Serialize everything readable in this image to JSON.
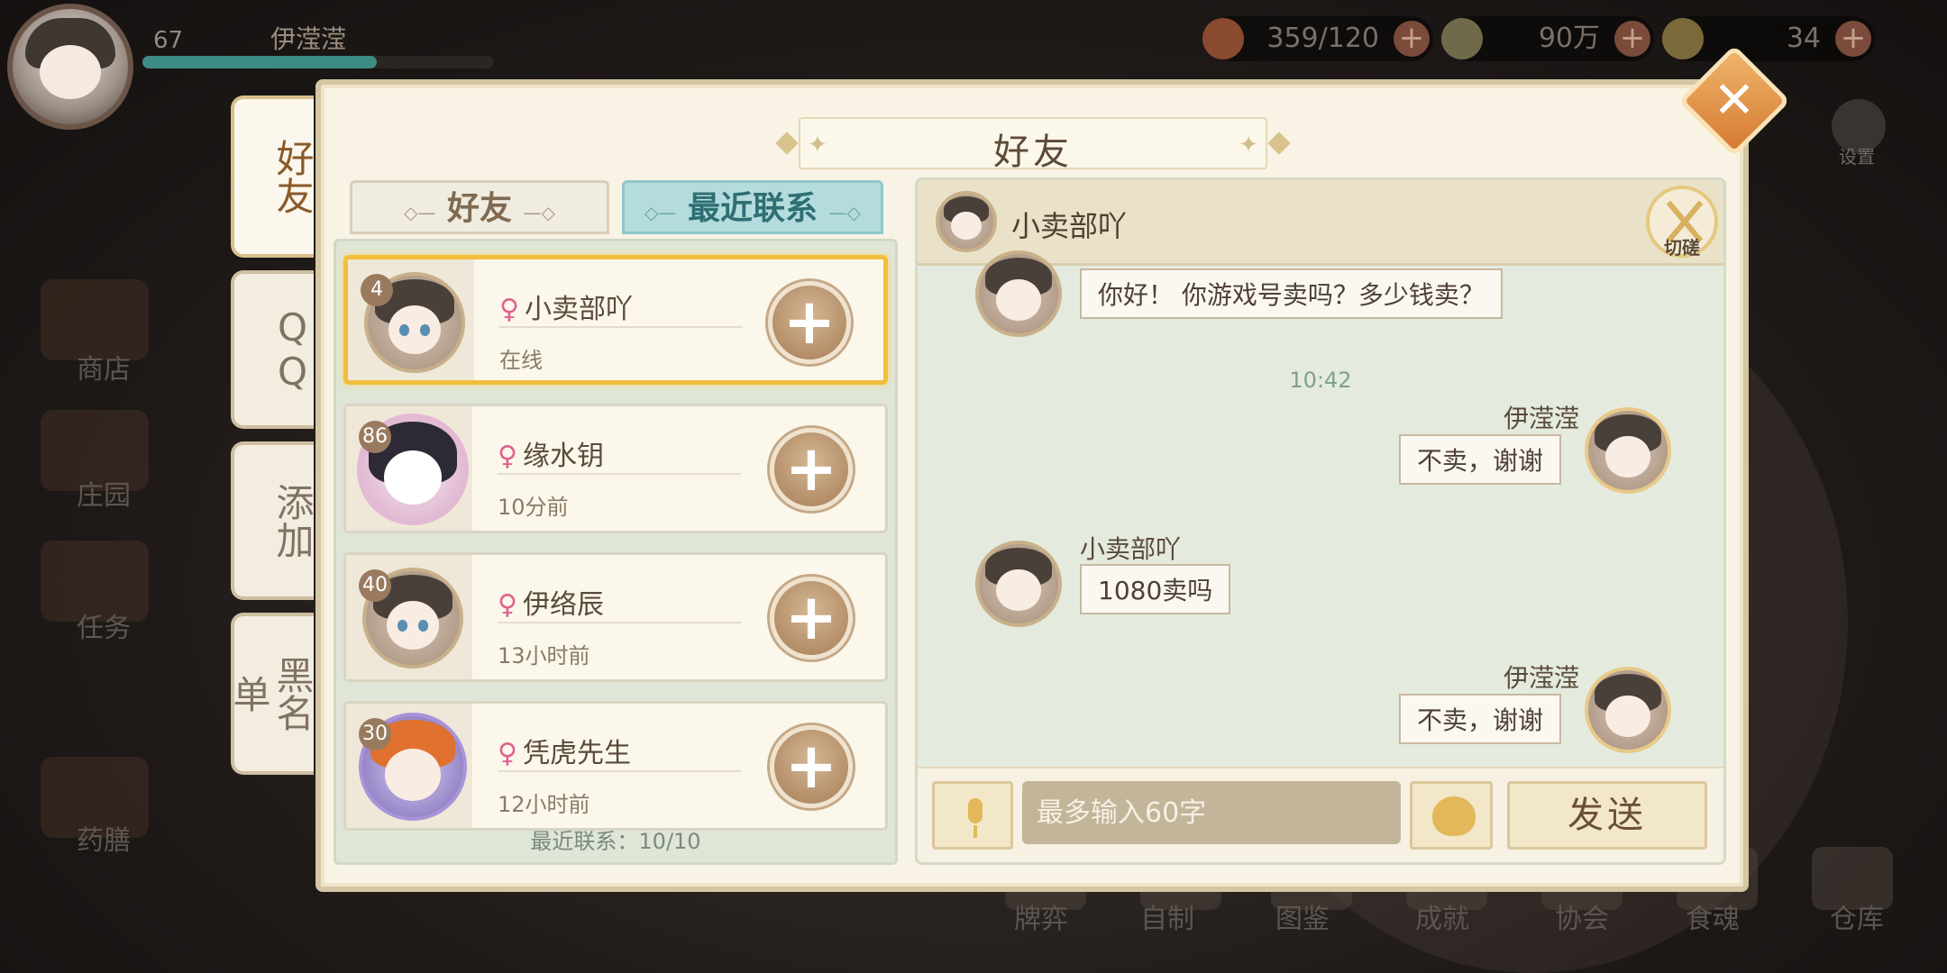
{
  "hud": {
    "level": "67",
    "player_name": "伊滢滢",
    "resources": [
      {
        "icon": "stamina-bowl-icon",
        "value": "359/120"
      },
      {
        "icon": "feather-coin-icon",
        "value": "90万"
      },
      {
        "icon": "gem-icon",
        "value": "34"
      }
    ],
    "settings_label": "设置"
  },
  "side_menu": {
    "items": [
      "商店",
      "庄园",
      "任务",
      "药膳"
    ]
  },
  "bottom_bar": {
    "items": [
      "牌弈",
      "自制",
      "图鉴",
      "成就",
      "协会",
      "食魂",
      "仓库"
    ]
  },
  "dialog": {
    "title": "好友",
    "vertical_tabs": [
      "好友",
      "QQ",
      "添加",
      "黑名单"
    ],
    "list_tabs": {
      "friends": "好友",
      "recent": "最近联系"
    },
    "friends": [
      {
        "level": "4",
        "name": "小卖部吖",
        "status": "在线",
        "gender": "♀"
      },
      {
        "level": "86",
        "name": "缘水钥",
        "status": "10分前",
        "gender": "♀"
      },
      {
        "level": "40",
        "name": "伊络辰",
        "status": "13小时前",
        "gender": "♀"
      },
      {
        "level": "30",
        "name": "凭虎先生",
        "status": "12小时前",
        "gender": "♀"
      }
    ],
    "list_footer": "最近联系：10/10"
  },
  "chat": {
    "partner_name": "小卖部吖",
    "spar_label": "切磋",
    "messages": [
      {
        "sender": "",
        "text": "你好！ 你游戏号卖吗？多少钱卖？"
      },
      {
        "time": "10:42"
      },
      {
        "sender": "伊滢滢",
        "text": "不卖，谢谢"
      },
      {
        "sender": "小卖部吖",
        "text": "1080卖吗"
      },
      {
        "sender": "伊滢滢",
        "text": "不卖，谢谢"
      }
    ],
    "input_placeholder": "最多输入60字",
    "send_label": "发送"
  }
}
